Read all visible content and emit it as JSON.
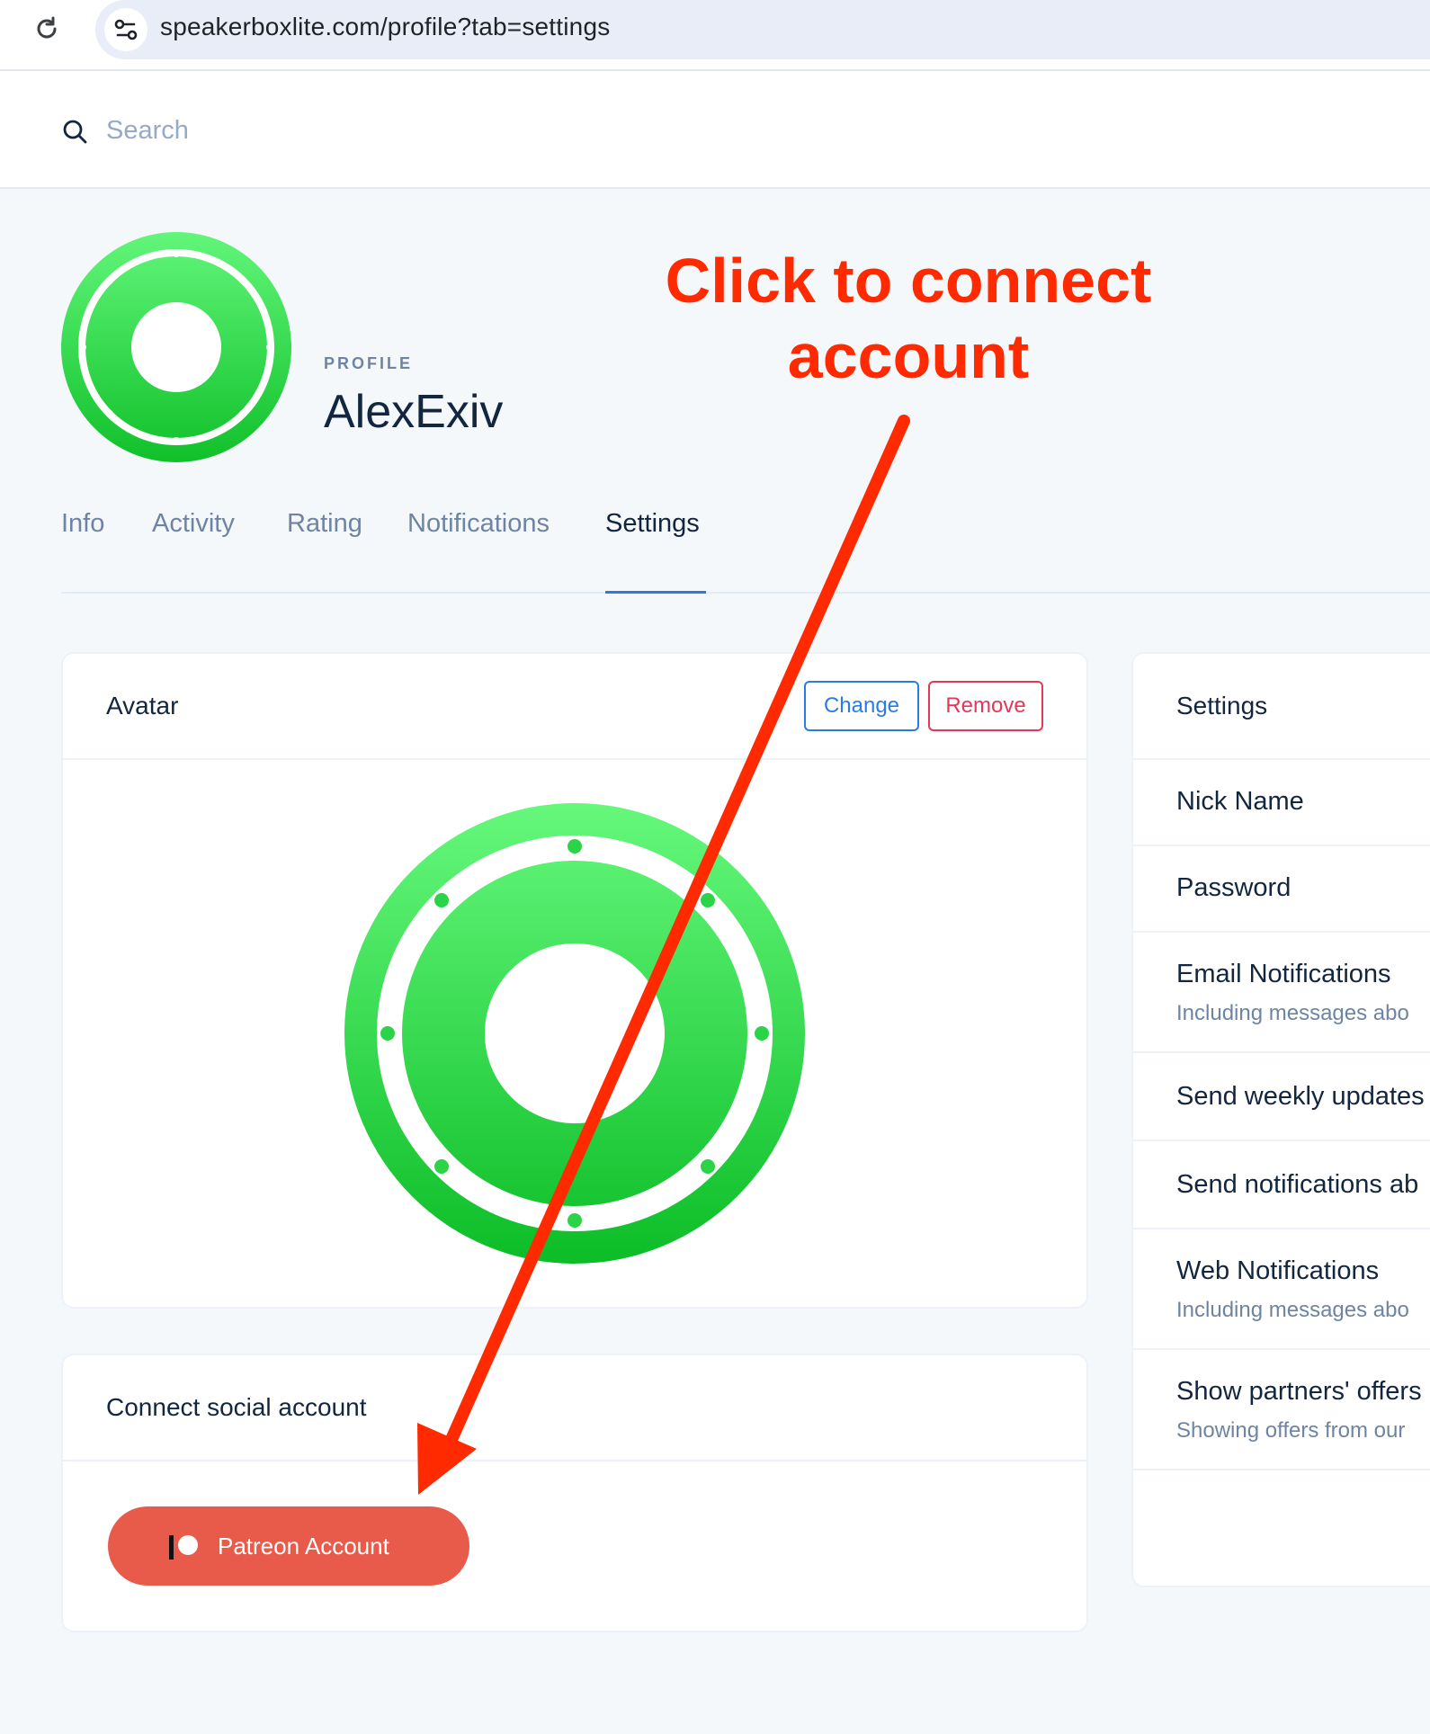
{
  "browser": {
    "url": "speakerboxlite.com/profile?tab=settings"
  },
  "search": {
    "placeholder": "Search"
  },
  "profile": {
    "pretitle": "PROFILE",
    "name": "AlexExiv"
  },
  "tabs": [
    {
      "label": "Info",
      "active": false
    },
    {
      "label": "Activity",
      "active": false
    },
    {
      "label": "Rating",
      "active": false
    },
    {
      "label": "Notifications",
      "active": false
    },
    {
      "label": "Settings",
      "active": true
    }
  ],
  "avatar_card": {
    "title": "Avatar",
    "change_label": "Change",
    "remove_label": "Remove"
  },
  "social_card": {
    "title": "Connect social account",
    "patreon_label": "Patreon Account"
  },
  "settings_card": {
    "title": "Settings",
    "items": [
      {
        "title": "Nick Name",
        "subtitle": ""
      },
      {
        "title": "Password",
        "subtitle": ""
      },
      {
        "title": "Email Notifications",
        "subtitle": "Including messages abo"
      },
      {
        "title": "Send weekly updates",
        "subtitle": ""
      },
      {
        "title": "Send notifications ab",
        "subtitle": ""
      },
      {
        "title": "Web Notifications",
        "subtitle": "Including messages abo"
      },
      {
        "title": "Show partners' offers",
        "subtitle": "Showing offers from our"
      }
    ]
  },
  "annotation": {
    "line1": "Click to connect",
    "line2": "account",
    "color": "#ff2a00"
  },
  "colors": {
    "primary": "#2c7be5",
    "danger": "#e63757",
    "patreon": "#e85b4a",
    "avatar_green": "#22c93f"
  }
}
